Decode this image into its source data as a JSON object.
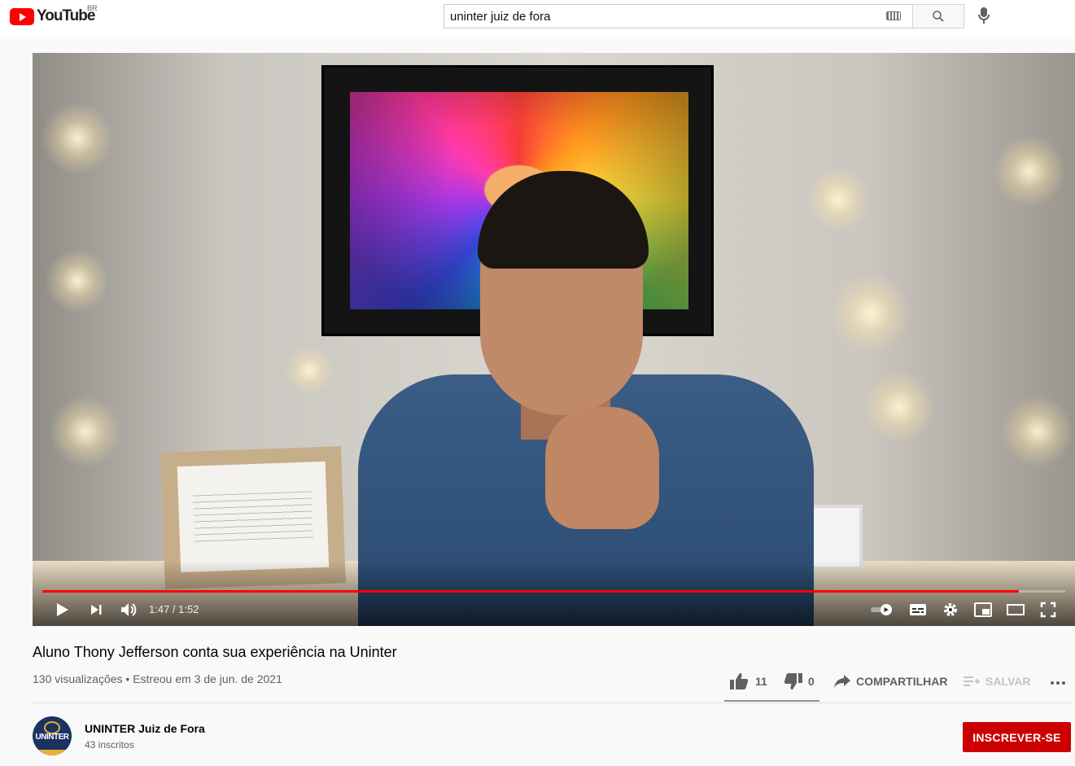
{
  "masthead": {
    "logo_text": "YouTube",
    "country_code": "BR",
    "search_value": "uninter juiz de fora"
  },
  "player": {
    "time_display": "1:47 / 1:52",
    "progress": 0.955,
    "buffered": 1.0
  },
  "video": {
    "title": "Aluno Thony Jefferson conta sua experiência na Uninter",
    "meta": "130 visualizações • Estreou em 3 de jun. de 2021"
  },
  "actions": {
    "likes": "11",
    "dislikes": "0",
    "share_label": "COMPARTILHAR",
    "save_label": "SALVAR"
  },
  "channel": {
    "avatar_text": "UNINTER",
    "name": "UNINTER Juiz de Fora",
    "subscribers": "43 inscritos",
    "subscribe_label": "INSCREVER-SE"
  },
  "colors": {
    "accent_red": "#cc0000",
    "progress_red": "#ff0000"
  }
}
